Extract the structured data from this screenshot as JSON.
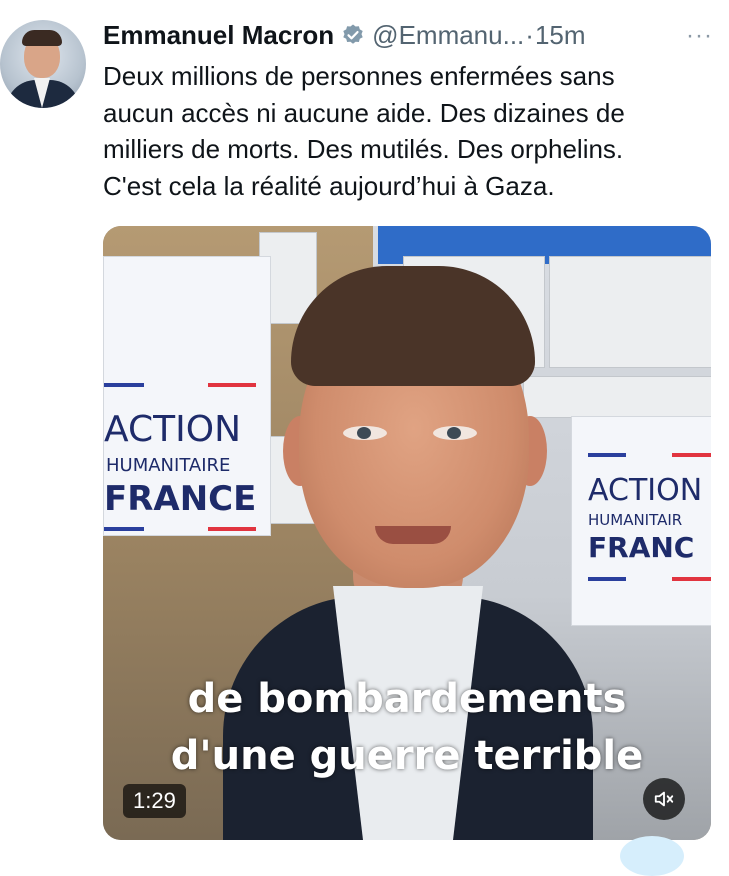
{
  "tweet": {
    "author_name": "Emmanuel Macron",
    "handle": "@Emmanu...",
    "separator": "·",
    "time": "15m",
    "more": "···",
    "text_lines": [
      "Deux millions de personnes enfermées sans",
      "aucun accès ni aucune aide. Des dizaines de",
      "milliers de morts. Des mutilés. Des orphelins.",
      "C'est cela la réalité aujourd’hui à Gaza."
    ]
  },
  "video": {
    "sign_left": {
      "line1": "ACTION",
      "line2": "HUMANITAIRE",
      "line3": "FRANCE"
    },
    "sign_right": {
      "line1": "ACTION",
      "line2": "HUMANITAIR",
      "line3": "FRANC"
    },
    "caption_lines": [
      "de bombardements",
      "d'une guerre terrible"
    ],
    "duration": "1:29",
    "mute_icon": "speaker-muted-icon"
  },
  "colors": {
    "verified": "#829aab",
    "handle_gray": "#536471",
    "sign_blue": "#1e2b6a",
    "flag_blue": "#2a3f9d",
    "flag_red": "#e1343f"
  }
}
